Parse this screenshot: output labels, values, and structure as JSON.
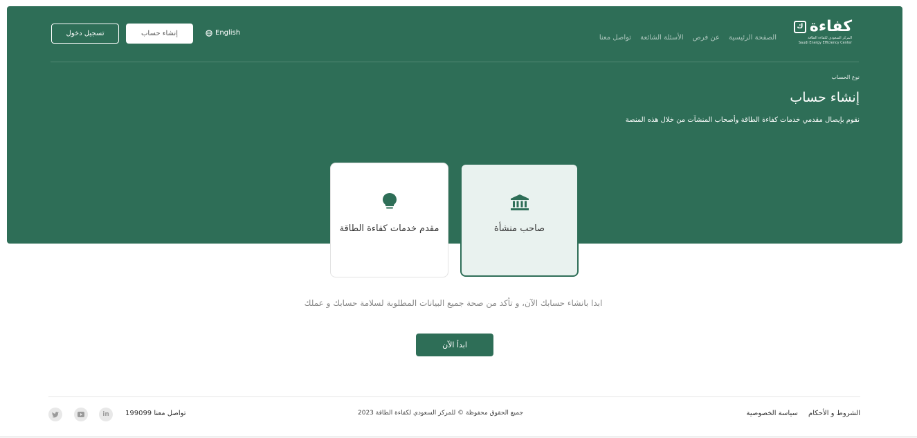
{
  "header": {
    "logo": {
      "word": "كفاءة",
      "mark": "ك",
      "subtitle_ar": "المركز السعودي لكفاءة الطاقة",
      "subtitle_en": "Saudi Energy Efficiency Center"
    },
    "nav": [
      "الصفحة الرئيسية",
      "عن فرص",
      "الأسئلة الشائعة",
      "تواصل معنا"
    ],
    "language_label": "English",
    "register_label": "إنشاء حساب",
    "login_label": "تسجيل دخول"
  },
  "hero": {
    "breadcrumb": "نوع الحساب",
    "title": "إنشاء حساب",
    "subtitle": "نقوم بإيصال مقدمي خدمات كفاءة الطاقة وأصحاب المنشآت من خلال هذه المنصة"
  },
  "account_types": [
    {
      "label": "صاحب منشأة",
      "icon": "institution-icon",
      "selected": true
    },
    {
      "label": "مقدم خدمات كفاءة الطاقة",
      "icon": "lightbulb-icon",
      "selected": false
    }
  ],
  "cta": {
    "text": "ابدا بانشاء حسابك الآن، و تأكد من صحة جميع البيانات المطلوبة لسلامة حسابك و عملك",
    "button_label": "ابدأ الآن"
  },
  "footer": {
    "links": [
      "الشروط و الأحكام",
      "سياسة الخصوصية"
    ],
    "copyright": "جميع الحقوق محفوظة © للمركز السعودي لكفاءة الطاقة 2023",
    "contact": "تواصل معنا 199099",
    "social": [
      "linkedin-icon",
      "youtube-icon",
      "twitter-icon"
    ]
  },
  "colors": {
    "primary": "#2e6e57",
    "selected_card_bg": "#e9f2ef",
    "white": "#ffffff"
  }
}
